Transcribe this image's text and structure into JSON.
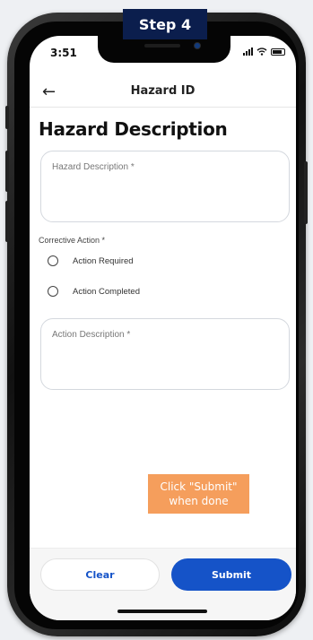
{
  "step_badge": "Step 4",
  "status": {
    "time": "3:51"
  },
  "header": {
    "title": "Hazard ID"
  },
  "page": {
    "heading": "Hazard Description"
  },
  "form": {
    "hazard_description_label": "Hazard Description *",
    "corrective_action_label": "Corrective Action *",
    "options": [
      {
        "label": "Action Required",
        "selected": false
      },
      {
        "label": "Action Completed",
        "selected": false
      }
    ],
    "action_description_label": "Action Description *"
  },
  "tip": {
    "line1": "Click \"Submit\"",
    "line2": "when done"
  },
  "footer": {
    "clear_label": "Clear",
    "submit_label": "Submit"
  },
  "colors": {
    "primary": "#1553c8",
    "badge": "#0b1e4d",
    "tip": "#f59e5c"
  }
}
